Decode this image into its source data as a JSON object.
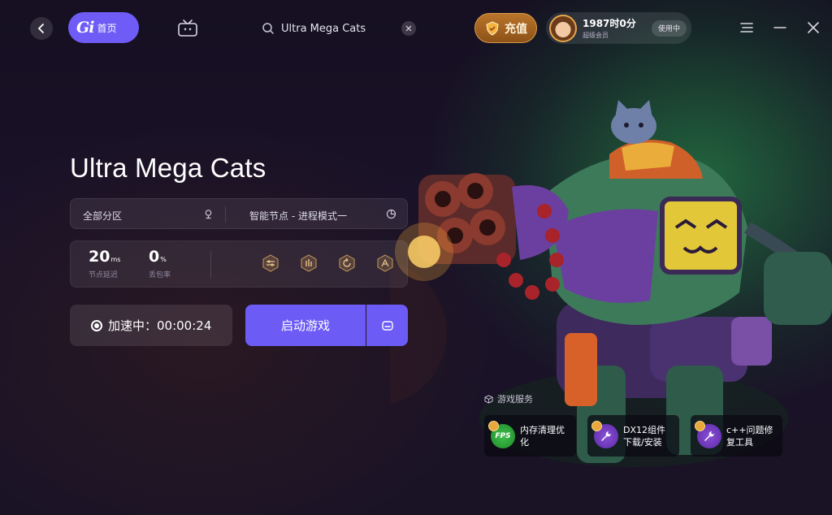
{
  "topbar": {
    "home_logo": "Gi",
    "home_label": "首页",
    "search_value": "Ultra Mega Cats",
    "recharge_label": "充值",
    "user_time": "1987时0分",
    "user_level": "超级会员",
    "user_status": "使用中",
    "icons": [
      "back-arrow-icon",
      "tv-icon",
      "search-icon",
      "close-icon",
      "shield-coin-icon",
      "menu-icon",
      "minimize-icon",
      "close-window-icon"
    ]
  },
  "game": {
    "title": "Ultra Mega Cats"
  },
  "selector": {
    "region": "全部分区",
    "node": "智能节点 - 进程模式一"
  },
  "stats": {
    "latency_value": "20",
    "latency_unit": "ms",
    "latency_label": "节点延迟",
    "loss_value": "0",
    "loss_unit": "%",
    "loss_label": "丢包率",
    "tools": [
      "settings-sliders-icon",
      "network-icon",
      "refresh-icon",
      "route-icon"
    ]
  },
  "actions": {
    "accel_label": "加速中：00:00:24",
    "start_label": "启动游戏"
  },
  "services": {
    "title": "游戏服务",
    "items": [
      {
        "label_line1": "内存清理优",
        "label_line2": "化",
        "icon": "FPS"
      },
      {
        "label_line1": "DX12组件",
        "label_line2": "下载/安装",
        "icon": "wrench-icon"
      },
      {
        "label_line1": "c++问题修",
        "label_line2": "复工具",
        "icon": "wrench-icon"
      }
    ]
  },
  "colors": {
    "accent": "#6c5cf5",
    "gold": "#b9752a",
    "background": "#14101f",
    "glow": "#2aa050"
  }
}
